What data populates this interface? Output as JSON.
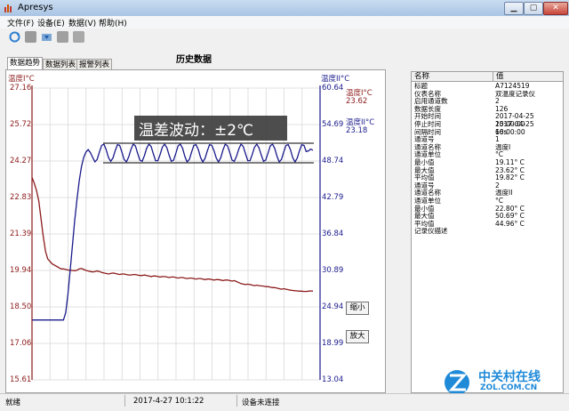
{
  "window": {
    "title": "Apresys"
  },
  "menu": [
    "文件(F)",
    "设备(E)",
    "数据(V)",
    "帮助(H)"
  ],
  "toolbar": [
    "refresh-icon",
    "stop-icon",
    "download-icon",
    "print-icon",
    "folder-icon"
  ],
  "section_title": "历史数据",
  "tabs": [
    "数据趋势",
    "数据列表",
    "报警列表"
  ],
  "chart_data": {
    "type": "line",
    "x": [
      0,
      1,
      2,
      3,
      4,
      5,
      6,
      7,
      8,
      9,
      10,
      11,
      12,
      13,
      14,
      15,
      16,
      17,
      18,
      19,
      20,
      21,
      22,
      23,
      24,
      25,
      26,
      27,
      28,
      29,
      30,
      31,
      32,
      33,
      34,
      35,
      36,
      37,
      38,
      39,
      40,
      41,
      42,
      43,
      44,
      45,
      46,
      47,
      48,
      49,
      50,
      51,
      52,
      53,
      54,
      55,
      56,
      57,
      58,
      59,
      60,
      61,
      62,
      63,
      64,
      65,
      66,
      67,
      68,
      69,
      70,
      71,
      72,
      73,
      74,
      75,
      76,
      77,
      78,
      79,
      80,
      81,
      82,
      83,
      84,
      85,
      86,
      87,
      88,
      89,
      90,
      91,
      92,
      93,
      94,
      95,
      96,
      97,
      98,
      99,
      100,
      101,
      102,
      103,
      104,
      105,
      106,
      107,
      108,
      109,
      110,
      111,
      112,
      113,
      114,
      115,
      116,
      117,
      118,
      119,
      120,
      121,
      122,
      123,
      124,
      125
    ],
    "left_axis": {
      "label": "温度I°C",
      "ticks": [
        "27.16",
        "25.72",
        "24.27",
        "22.83",
        "21.39",
        "19.94",
        "18.50",
        "17.06",
        "15.61"
      ],
      "ylim": [
        15.61,
        27.16
      ]
    },
    "right_axis": {
      "label": "温度II°C",
      "ticks": [
        "60.64",
        "54.69",
        "48.74",
        "42.79",
        "36.84",
        "30.89",
        "24.94",
        "18.99",
        "13.04"
      ],
      "ylim": [
        13.04,
        60.64
      ]
    },
    "series": [
      {
        "name": "温度I°C",
        "axis": "left",
        "color": "#8b1a1a",
        "values": [
          23.62,
          23.4,
          23.1,
          22.7,
          22.0,
          21.3,
          20.7,
          20.4,
          20.3,
          20.2,
          20.15,
          20.1,
          20.05,
          20.0,
          20.0,
          19.98,
          19.96,
          19.95,
          19.94,
          19.93,
          19.95,
          20.0,
          20.02,
          19.98,
          19.94,
          19.92,
          19.9,
          19.88,
          19.9,
          19.92,
          19.9,
          19.86,
          19.84,
          19.82,
          19.8,
          19.82,
          19.84,
          19.82,
          19.8,
          19.78,
          19.8,
          19.8,
          19.78,
          19.76,
          19.76,
          19.78,
          19.78,
          19.76,
          19.74,
          19.74,
          19.76,
          19.74,
          19.72,
          19.7,
          19.72,
          19.72,
          19.7,
          19.68,
          19.7,
          19.7,
          19.68,
          19.66,
          19.68,
          19.68,
          19.66,
          19.64,
          19.66,
          19.66,
          19.64,
          19.62,
          19.64,
          19.64,
          19.62,
          19.6,
          19.62,
          19.62,
          19.6,
          19.58,
          19.6,
          19.6,
          19.58,
          19.56,
          19.58,
          19.58,
          19.56,
          19.54,
          19.56,
          19.56,
          19.54,
          19.52,
          19.54,
          19.5,
          19.46,
          19.42,
          19.4,
          19.38,
          19.4,
          19.38,
          19.36,
          19.34,
          19.36,
          19.34,
          19.33,
          19.32,
          19.3,
          19.3,
          19.28,
          19.26,
          19.26,
          19.24,
          19.22,
          19.2,
          19.22,
          19.2,
          19.18,
          19.16,
          19.15,
          19.14,
          19.13,
          19.12,
          19.12,
          19.11,
          19.11,
          19.12,
          19.13,
          19.12
        ]
      },
      {
        "name": "温度II°C",
        "axis": "right",
        "color": "#1a1a8b",
        "values": [
          22.8,
          22.8,
          22.8,
          22.8,
          22.8,
          22.8,
          22.8,
          22.8,
          22.8,
          22.8,
          22.8,
          22.8,
          22.8,
          22.8,
          22.8,
          24.0,
          27.0,
          31.0,
          35.0,
          39.0,
          42.5,
          45.5,
          47.8,
          49.3,
          50.2,
          50.6,
          50.1,
          49.3,
          48.6,
          49.0,
          50.2,
          51.3,
          51.5,
          50.6,
          49.3,
          48.7,
          49.2,
          50.4,
          51.4,
          51.3,
          50.2,
          49.0,
          48.6,
          49.4,
          50.6,
          51.5,
          51.2,
          50.0,
          48.9,
          48.7,
          49.6,
          50.8,
          51.5,
          51.1,
          49.9,
          48.8,
          48.8,
          49.8,
          51.0,
          51.5,
          50.9,
          49.7,
          48.7,
          48.9,
          50.0,
          51.2,
          51.5,
          50.8,
          49.5,
          48.6,
          49.0,
          50.2,
          51.3,
          51.4,
          50.6,
          49.3,
          48.6,
          49.2,
          50.4,
          51.4,
          51.3,
          50.4,
          49.2,
          48.6,
          49.3,
          50.6,
          51.5,
          51.2,
          50.1,
          48.9,
          48.7,
          49.5,
          50.7,
          51.5,
          51.1,
          49.9,
          48.8,
          48.8,
          49.8,
          51.0,
          51.5,
          50.9,
          49.7,
          48.7,
          48.9,
          50.0,
          51.2,
          51.5,
          50.8,
          49.5,
          48.6,
          49.0,
          50.2,
          51.3,
          51.4,
          50.6,
          49.3,
          48.6,
          49.2,
          50.4,
          51.4,
          51.3,
          50.3,
          50.4,
          50.69,
          50.5
        ]
      }
    ],
    "current_values": {
      "left": "23.62",
      "right": "23.18"
    },
    "annotation": "温差波动：±2℃",
    "grid": true
  },
  "buttons": {
    "zoom_out": "缩小",
    "zoom_in": "放大"
  },
  "properties": {
    "header_name": "名称",
    "header_value": "值",
    "rows": [
      [
        "标题",
        "A7124519"
      ],
      [
        "仪表名称",
        "双温度记录仪"
      ],
      [
        "启用通道数",
        "2"
      ],
      [
        "数据长度",
        "126"
      ],
      [
        "开始时间",
        "2017-04-25 15:00:00"
      ],
      [
        "停止时间",
        "2017-04-25 16:00:00"
      ],
      [
        "间隔时间",
        "60s"
      ],
      [
        "通道号",
        "1"
      ],
      [
        "通道名称",
        "温度I"
      ],
      [
        "通道单位",
        "°C"
      ],
      [
        "最小值",
        "19.11° C"
      ],
      [
        "最大值",
        "23.62° C"
      ],
      [
        "平均值",
        "19.82° C"
      ],
      [
        "通道号",
        "2"
      ],
      [
        "通道名称",
        "温度II"
      ],
      [
        "通道单位",
        "°C"
      ],
      [
        "最小值",
        "22.80° C"
      ],
      [
        "最大值",
        "50.69° C"
      ],
      [
        "平均值",
        "44.96° C"
      ],
      [
        "记录仪描述",
        ""
      ]
    ]
  },
  "status": {
    "ready": "就绪",
    "datetime": "2017-4-27 10:1:22",
    "device": "设备未连接"
  },
  "watermark": {
    "brand": "中关村在线",
    "site": "ZOL.COM.CN"
  }
}
